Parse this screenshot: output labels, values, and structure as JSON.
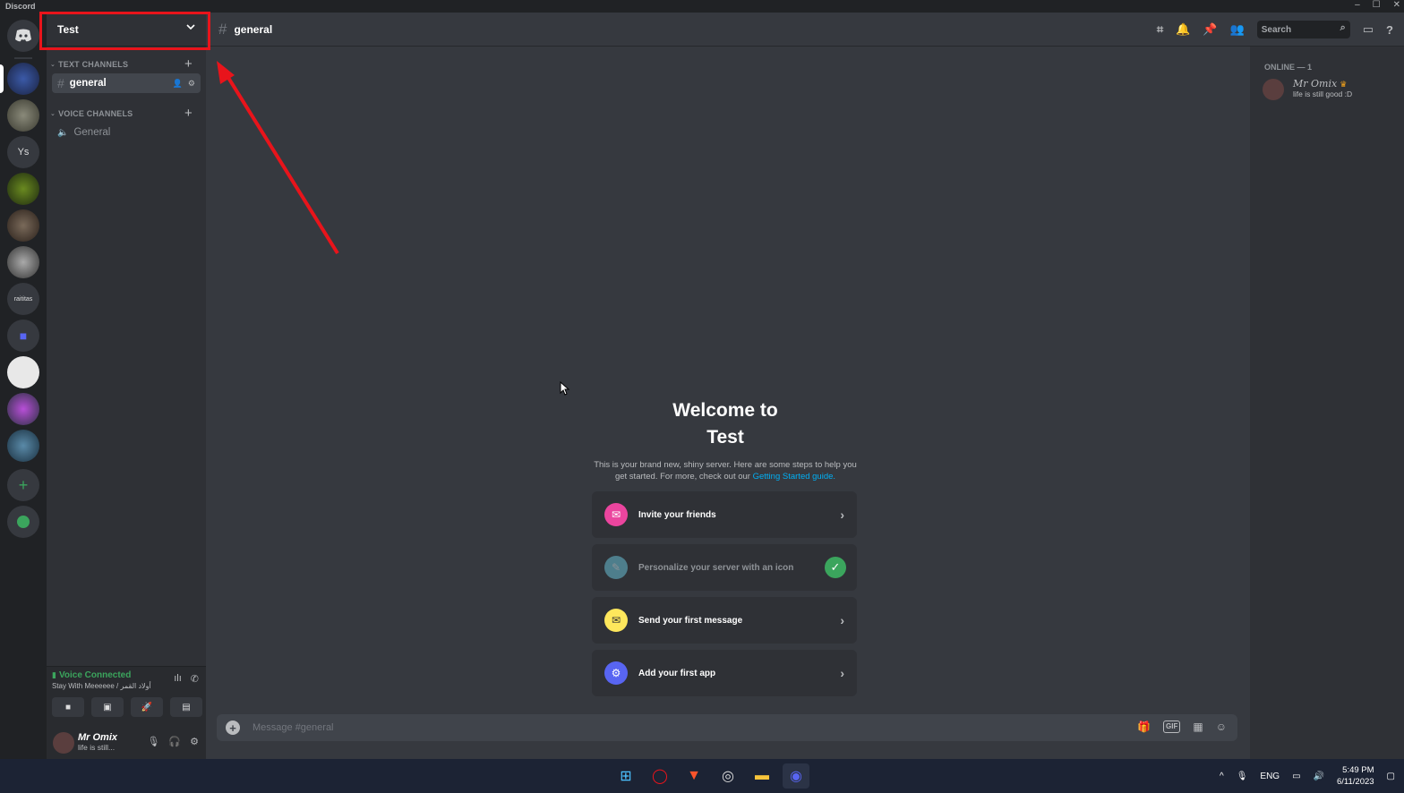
{
  "window": {
    "title": "Discord",
    "controls": [
      "–",
      "☐",
      "✕"
    ]
  },
  "server": {
    "name": "Test"
  },
  "guilds": [
    {
      "name": "home",
      "label": ""
    },
    {
      "name": "server-1",
      "label": ""
    },
    {
      "name": "server-2",
      "label": ""
    },
    {
      "name": "server-ys",
      "label": "Ys"
    },
    {
      "name": "server-4",
      "label": ""
    },
    {
      "name": "server-5",
      "label": ""
    },
    {
      "name": "server-6",
      "label": ""
    },
    {
      "name": "server-raititas",
      "label": "raititas"
    },
    {
      "name": "folder",
      "label": ""
    },
    {
      "name": "server-9",
      "label": ""
    },
    {
      "name": "server-10",
      "label": ""
    },
    {
      "name": "server-11",
      "label": ""
    }
  ],
  "sidebar": {
    "text_category": "TEXT CHANNELS",
    "voice_category": "VOICE CHANNELS",
    "text_channels": [
      {
        "name": "general"
      }
    ],
    "voice_channels": [
      {
        "name": "General"
      }
    ]
  },
  "voice": {
    "status": "Voice Connected",
    "subtitle": "Stay With Meeeeee / أولاد القمر"
  },
  "user": {
    "name": "Mr Omix",
    "status": "life is still..."
  },
  "channel": {
    "name": "general"
  },
  "header": {
    "search_placeholder": "Search"
  },
  "welcome": {
    "title_line1": "Welcome to",
    "title_line2": "Test",
    "body": "This is your brand new, shiny server. Here are some steps to help you get started. For more, check out our",
    "link": "Getting Started guide."
  },
  "cards": [
    {
      "label": "Invite your friends",
      "done": false,
      "icon_color": "#eb459e"
    },
    {
      "label": "Personalize your server with an icon",
      "done": true,
      "icon_color": "#4e7e8c"
    },
    {
      "label": "Send your first message",
      "done": false,
      "icon_color": "#fee75c"
    },
    {
      "label": "Add your first app",
      "done": false,
      "icon_color": "#5865f2"
    }
  ],
  "message": {
    "placeholder": "Message #general"
  },
  "members": {
    "section": "ONLINE — 1",
    "list": [
      {
        "name": "Mr Omix",
        "status": "life is still good :D"
      }
    ]
  },
  "taskbar": {
    "lang": "ENG",
    "time": "5:49 PM",
    "date": "6/11/2023"
  },
  "colors": {
    "accent": "#5865f2",
    "online": "#3ba55d",
    "annotation": "#e8141b",
    "link": "#00aff4"
  }
}
